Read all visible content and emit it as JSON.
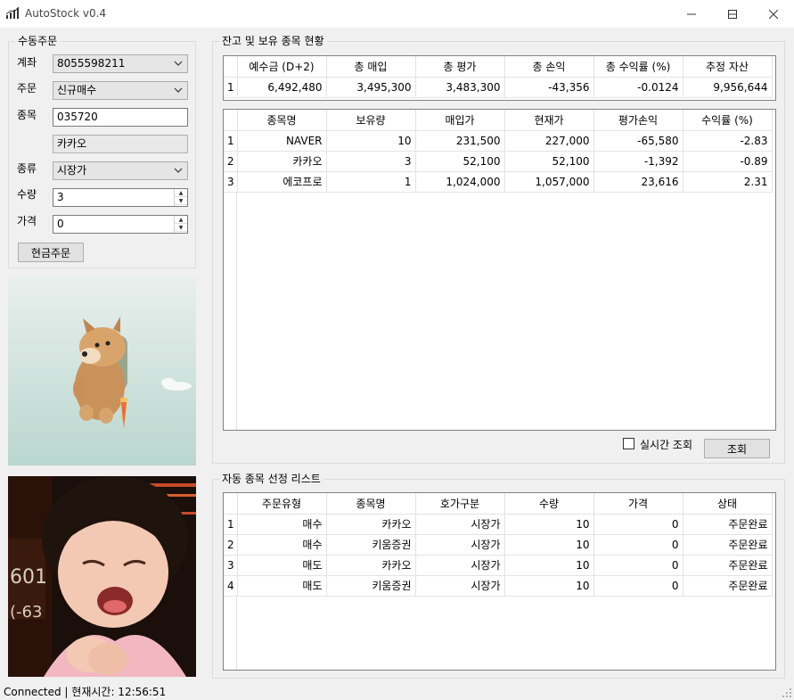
{
  "window": {
    "title": "AutoStock v0.4",
    "minimize_glyph": "—",
    "maximize_glyph": "☐",
    "close_glyph": "✕"
  },
  "manual_order": {
    "group_label": "수동주문",
    "account_label": "계좌",
    "account_value": "8055598211",
    "order_label": "주문",
    "order_value": "신규매수",
    "code_label": "종목",
    "code_value": "035720",
    "name_value": "카카오",
    "type_label": "종류",
    "type_value": "시장가",
    "qty_label": "수량",
    "qty_value": "3",
    "price_label": "가격",
    "price_value": "0",
    "submit_label": "현금주문"
  },
  "balance": {
    "group_label": "잔고 및 보유 종목 현황",
    "summary_headers": [
      "예수금 (D+2)",
      "총 매입",
      "총 평가",
      "총 손익",
      "총 수익률 (%)",
      "추정 자산"
    ],
    "summary_rows": [
      [
        "1",
        "6,492,480",
        "3,495,300",
        "3,483,300",
        "-43,356",
        "-0.0124",
        "9,956,644"
      ]
    ],
    "holdings_headers": [
      "종목명",
      "보유량",
      "매입가",
      "현재가",
      "평가손익",
      "수익률 (%)"
    ],
    "holdings_rows": [
      [
        "1",
        "NAVER",
        "10",
        "231,500",
        "227,000",
        "-65,580",
        "-2.83"
      ],
      [
        "2",
        "카카오",
        "3",
        "52,100",
        "52,100",
        "-1,392",
        "-0.89"
      ],
      [
        "3",
        "에코프로",
        "1",
        "1,024,000",
        "1,057,000",
        "23,616",
        "2.31"
      ]
    ],
    "realtime_label": "실시간 조회",
    "query_label": "조회"
  },
  "auto_list": {
    "group_label": "자동 종목 선정 리스트",
    "headers": [
      "주문유형",
      "종목명",
      "호가구분",
      "수량",
      "가격",
      "상태"
    ],
    "rows": [
      [
        "1",
        "매수",
        "카카오",
        "시장가",
        "10",
        "0",
        "주문완료"
      ],
      [
        "2",
        "매수",
        "키움증권",
        "시장가",
        "10",
        "0",
        "주문완료"
      ],
      [
        "3",
        "매도",
        "카카오",
        "시장가",
        "10",
        "0",
        "주문완료"
      ],
      [
        "4",
        "매도",
        "키움증권",
        "시장가",
        "10",
        "0",
        "주문완료"
      ]
    ]
  },
  "status": {
    "text": "Connected | 현재시간: 12:56:51"
  },
  "images": {
    "top_alt": "flying-doge-jetpack",
    "bottom_alt": "crying-girl-stock-board"
  }
}
